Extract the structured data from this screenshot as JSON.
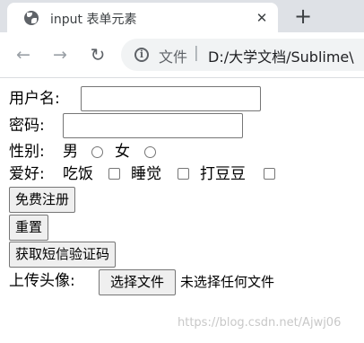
{
  "browser": {
    "tab_title": "input 表单元素",
    "tab_close": "✕",
    "new_tab": "+",
    "back": "←",
    "forward": "→",
    "reload": "↻",
    "info_glyph": "i",
    "url_label": "文件",
    "url_separator": "|",
    "url": "D:/大学文档/Sublime\\"
  },
  "form": {
    "username_label": "用户名:",
    "username_value": "",
    "password_label": "密码:",
    "password_value": "",
    "gender_label": "性别:",
    "gender_options": [
      "男",
      "女"
    ],
    "hobby_label": "爱好:",
    "hobby_options": [
      "吃饭",
      "睡觉",
      "打豆豆"
    ],
    "register_button": "免费注册",
    "reset_button": "重置",
    "sms_button": "获取短信验证码",
    "avatar_label": "上传头像:",
    "choose_file_button": "选择文件",
    "no_file_text": "未选择任何文件"
  },
  "watermark": "https://blog.csdn.net/Ajwj06"
}
